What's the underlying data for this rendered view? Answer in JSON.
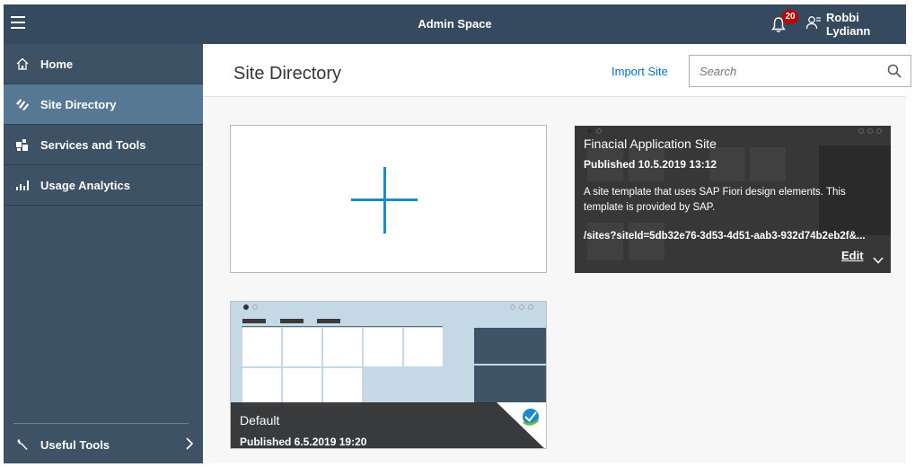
{
  "shell": {
    "title": "Admin Space",
    "notification_count": "20",
    "user_name": "Robbi Lydiann"
  },
  "sidebar": {
    "items": [
      {
        "label": "Home",
        "icon": "home-icon",
        "active": false
      },
      {
        "label": "Site Directory",
        "icon": "site-directory-icon",
        "active": true
      },
      {
        "label": "Services and Tools",
        "icon": "services-tools-icon",
        "active": false
      },
      {
        "label": "Usage Analytics",
        "icon": "analytics-icon",
        "active": false
      }
    ],
    "footer": {
      "label": "Useful Tools",
      "icon": "wrench-icon"
    }
  },
  "main": {
    "title": "Site Directory",
    "import_label": "Import Site",
    "search": {
      "placeholder": "Search",
      "value": ""
    }
  },
  "sites": [
    {
      "title": "Finacial Application Site",
      "published": "Published 10.5.2019 13:12",
      "description": "A site template that uses SAP Fiori design elements. This template is provided by SAP.",
      "url": "/sites?siteId=5db32e76-3d53-4d51-aab3-932d74b2eb2f&...",
      "edit_label": "Edit"
    },
    {
      "title": "Default",
      "published": "Published 6.5.2019 19:20"
    }
  ],
  "colors": {
    "shell": "#354a5f",
    "sidebar": "#3e5266",
    "sidebar_active": "#577894",
    "link": "#0a6ed1",
    "plus": "#1a8bcb",
    "badge": "#bb0000"
  }
}
